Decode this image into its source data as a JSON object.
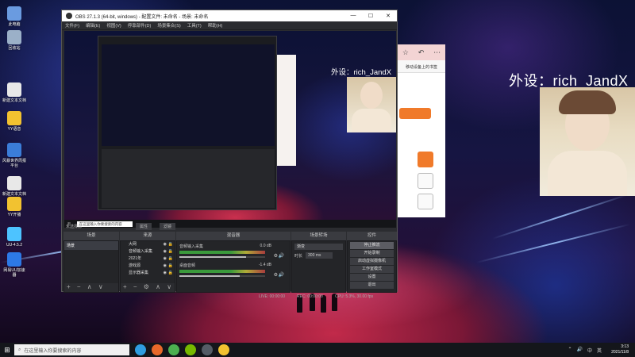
{
  "desktop": {
    "icons": [
      {
        "label": "此电脑",
        "color": "#6a9be0"
      },
      {
        "label": "回收站",
        "color": "#9bb0c8"
      },
      {
        "label": "新建文本文档",
        "color": "#e8e8e8"
      },
      {
        "label": "YY语音",
        "color": "#f2c230"
      },
      {
        "label": "风暴世界周报\n平台",
        "color": "#3b7dd8"
      },
      {
        "label": "新建文本文档\n(2)",
        "color": "#e8e8e8"
      },
      {
        "label": "YY开播",
        "color": "#f2c230"
      },
      {
        "label": "UU-4.5.2",
        "color": "#4dc3ff"
      },
      {
        "label": "网易UU加速\n器",
        "color": "#2d79e6"
      }
    ]
  },
  "overlay": {
    "text": "外设：rich_JandX",
    "preview_text": "外设：rich_JandX"
  },
  "obs": {
    "title": "OBS 27.1.3 (64-bit, windows) - 配置文件: 未命名 - 场景: 未命名",
    "window_controls": [
      "—",
      "☐",
      "✕"
    ],
    "menu": [
      "文件(F)",
      "编辑(E)",
      "视图(V)",
      "停靠部件(D)",
      "场景集合(S)",
      "工具(T)",
      "帮助(H)"
    ],
    "preview_taskbar_search": "在这里输入你要搜索的内容",
    "source_bar": {
      "label": "未选择源",
      "prop_btn": "属性",
      "filter_btn": "滤镜"
    },
    "docks": {
      "scenes": {
        "title": "场景",
        "items": [
          "场景"
        ]
      },
      "sources": {
        "title": "来源",
        "items": [
          "大网",
          "音频输入采集",
          "2021年",
          "游戏源",
          "显示器采集"
        ]
      },
      "mixer": {
        "title": "混音器",
        "channels": [
          {
            "name": "音频输入采集",
            "db": "0.0 dB",
            "level": 0.78
          },
          {
            "name": "桌面音频",
            "db": "-1.4 dB",
            "level": 0.7
          }
        ]
      },
      "transitions": {
        "title": "场景转场",
        "selected": "渐变",
        "duration_label": "时长",
        "duration_value": "300 ms"
      },
      "controls": {
        "title": "控件",
        "buttons": [
          "停止推流",
          "开始录制",
          "启动虚拟摄像机",
          "工作室模式",
          "设置",
          "退出"
        ]
      }
    },
    "status": {
      "live": "LIVE: 00:00:00",
      "rec": "REC: 00:00:00",
      "cpu": "CPU: 5.3%, 30.00 fps"
    }
  },
  "browser": {
    "addr": "移动设备上的书签"
  },
  "taskbar": {
    "search_placeholder": "在这里输入你要搜索的内容",
    "apps": [
      {
        "name": "edge",
        "color": "#2f9de0"
      },
      {
        "name": "firefox",
        "color": "#e8682a"
      },
      {
        "name": "chrome",
        "color": "#4caf50"
      },
      {
        "name": "nvidia",
        "color": "#76b900"
      },
      {
        "name": "obs",
        "color": "#555c66"
      },
      {
        "name": "yy",
        "color": "#f2c230"
      }
    ],
    "tray": [
      "⌃",
      "🔊",
      "中",
      "英"
    ],
    "time": "3:13",
    "date": "2021/11/8"
  }
}
